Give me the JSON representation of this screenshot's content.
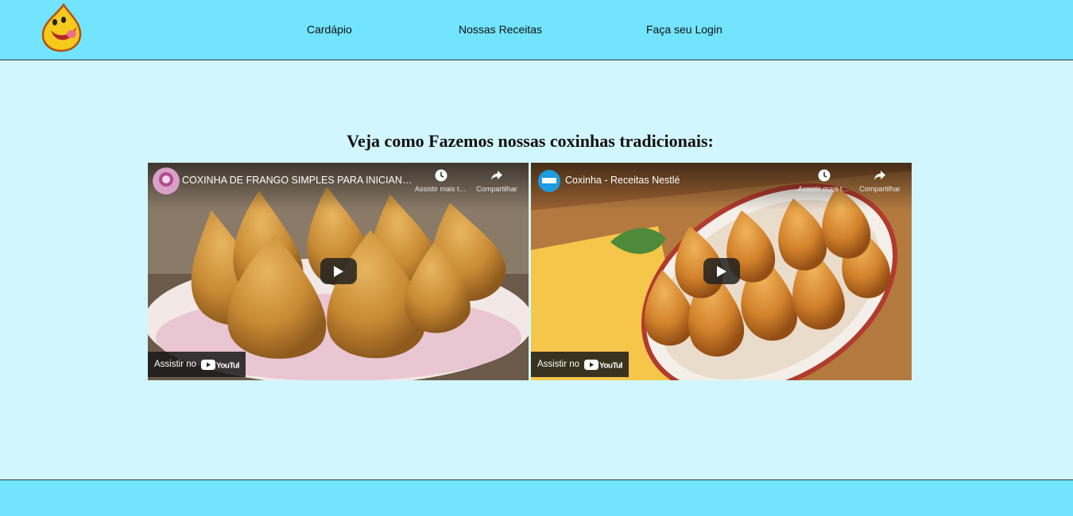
{
  "header": {
    "logo_icon": "smiling-drop-logo",
    "nav": {
      "menu": "Cardápio",
      "recipes": "Nossas Receitas",
      "login": "Faça seu Login"
    }
  },
  "main": {
    "heading": "Veja como Fazemos nossas coxinhas tradicionais:",
    "videos": [
      {
        "title": "COXINHA DE FRANGO SIMPLES PARA INICIANTES | Receitas De Pai",
        "watch_later": "Assistir mais tarde",
        "share": "Compartilhar",
        "watch_on": "Assistir no",
        "platform": "YouTube"
      },
      {
        "title": "Coxinha - Receitas Nestlé",
        "watch_later": "Assistir mais tarde",
        "share": "Compartilhar",
        "watch_on": "Assistir no",
        "platform": "YouTube"
      }
    ]
  },
  "colors": {
    "header_bg": "#72e4fd",
    "page_bg": "#d2f6fe",
    "footer_bg": "#72e4fd"
  }
}
